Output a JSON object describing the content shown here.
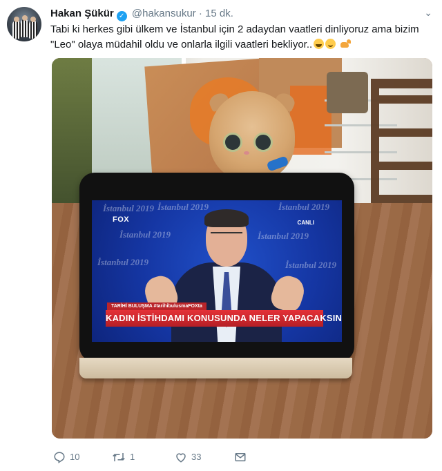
{
  "tweet": {
    "author_name": "Hakan Şükür",
    "verified_mark": "✓",
    "handle": "@hakansukur",
    "separator": "·",
    "time": "15 dk.",
    "menu_glyph": "⌄",
    "text_line1": "Tabi ki herkes gibi ülkem ve İstanbul için 2 adaydan vaatleri dinliyoruz ama bizim",
    "text_line2": "\"Leo\" olaya müdahil oldu ve onlarla ilgili vaatleri bekliyor..",
    "emojis": [
      "grinning-squinting-face",
      "winking-face",
      "cat"
    ]
  },
  "photo": {
    "tv_channel": "FOX",
    "tv_live": "CANLI",
    "tv_watermark": "İstanbul 2019",
    "tv_hashtag": "TARİHİ BULUŞMA #tarihibulusmaFOXta",
    "tv_ticker": "KADIN İSTİHDAMI KONUSUNDA NELER YAPACAKSINIZ?"
  },
  "actions": {
    "reply": {
      "icon": "reply-icon",
      "count": "10"
    },
    "retweet": {
      "icon": "retweet-icon",
      "count": "1"
    },
    "like": {
      "icon": "heart-icon",
      "count": "33"
    },
    "dm": {
      "icon": "mail-icon"
    }
  },
  "colors": {
    "verified_blue": "#1da1f2",
    "muted_text": "#657786",
    "text": "#14171a"
  }
}
